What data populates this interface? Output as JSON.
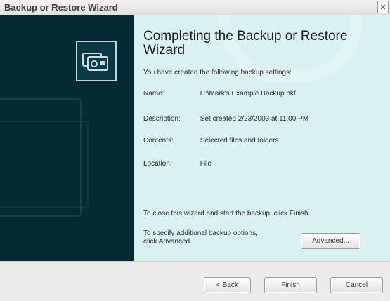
{
  "window": {
    "title": "Backup or Restore Wizard",
    "close_glyph": "✕"
  },
  "main": {
    "heading": "Completing the Backup or Restore Wizard",
    "intro": "You have created the following backup settings:",
    "settings": [
      {
        "label": "Name:",
        "value": "H:\\Mark's Example Backup.bkf"
      },
      {
        "label": "Description:",
        "value": "Set created 2/23/2003 at 11:00 PM"
      },
      {
        "label": "Contents:",
        "value": "Selected files and folders"
      },
      {
        "label": "Location:",
        "value": "File"
      }
    ],
    "close_instruction": "To close this wizard and start the backup, click Finish.",
    "advanced_instruction": "To specify additional backup options, click Advanced.",
    "advanced_button": "Advanced..."
  },
  "buttons": {
    "back": "< Back",
    "finish": "Finish",
    "cancel": "Cancel"
  },
  "icons": {
    "wizard": "backup-wizard-icon",
    "close": "close-icon"
  },
  "colors": {
    "sidebar": "#062a33",
    "content": "#d9f2ef",
    "background": "#ececec"
  }
}
